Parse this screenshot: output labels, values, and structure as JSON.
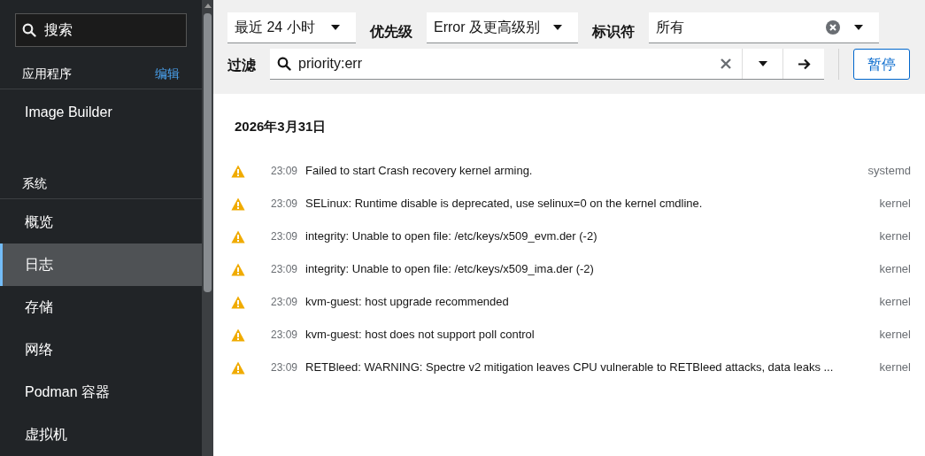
{
  "sidebar": {
    "search": {
      "placeholder": "搜索"
    },
    "sections": [
      {
        "title": "应用程序",
        "action": "编辑",
        "items": [
          {
            "label": "Image Builder",
            "selected": false
          }
        ]
      },
      {
        "title": "系统",
        "items": [
          {
            "label": "概览",
            "selected": false
          },
          {
            "label": "日志",
            "selected": true
          },
          {
            "label": "存储",
            "selected": false
          },
          {
            "label": "网络",
            "selected": false
          },
          {
            "label": "Podman 容器",
            "selected": false
          },
          {
            "label": "虚拟机",
            "selected": false
          }
        ]
      }
    ]
  },
  "filters": {
    "time_range": {
      "value": "最近 24 小时"
    },
    "priority": {
      "label": "优先级",
      "value": "Error 及更高级别"
    },
    "identifier": {
      "label": "标识符",
      "value": "所有"
    },
    "filter": {
      "label": "过滤",
      "value": "priority:err"
    },
    "pause_button": "暂停"
  },
  "log": {
    "date": "2026年3月31日",
    "entries": [
      {
        "kind": "warning",
        "time": "23:09",
        "message": "Failed to start Crash recovery kernel arming.",
        "source": "systemd"
      },
      {
        "kind": "warning",
        "time": "23:09",
        "message": "SELinux: Runtime disable is deprecated, use selinux=0 on the kernel cmdline.",
        "source": "kernel"
      },
      {
        "kind": "warning",
        "time": "23:09",
        "message": "integrity: Unable to open file: /etc/keys/x509_evm.der (-2)",
        "source": "kernel"
      },
      {
        "kind": "warning",
        "time": "23:09",
        "message": "integrity: Unable to open file: /etc/keys/x509_ima.der (-2)",
        "source": "kernel"
      },
      {
        "kind": "warning",
        "time": "23:09",
        "message": "kvm-guest: host upgrade recommended",
        "source": "kernel"
      },
      {
        "kind": "warning",
        "time": "23:09",
        "message": "kvm-guest: host does not support poll control",
        "source": "kernel"
      },
      {
        "kind": "warning",
        "time": "23:09",
        "message": "RETBleed: WARNING: Spectre v2 mitigation leaves CPU vulnerable to RETBleed attacks, data leaks ...",
        "source": "kernel"
      }
    ]
  }
}
